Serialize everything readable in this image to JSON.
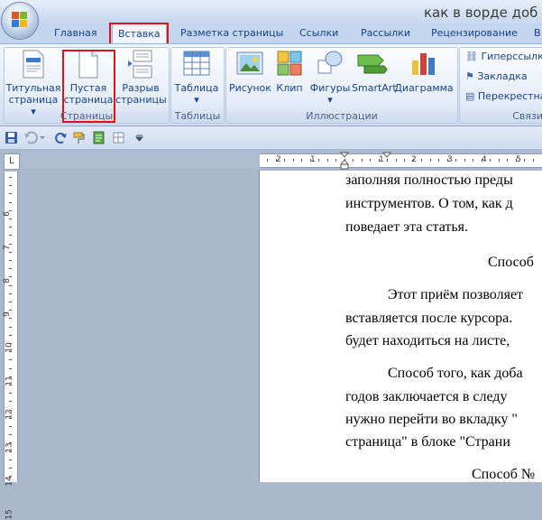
{
  "window": {
    "title": "как в ворде доб"
  },
  "tabs": [
    {
      "label": "Главная"
    },
    {
      "label": "Вставка"
    },
    {
      "label": "Разметка страницы"
    },
    {
      "label": "Ссылки"
    },
    {
      "label": "Рассылки"
    },
    {
      "label": "Рецензирование"
    },
    {
      "label": "В"
    }
  ],
  "ribbon": {
    "pages_group": {
      "label": "Страницы",
      "cover_page": {
        "line1": "Титульная",
        "line2": "страница ▾"
      },
      "blank_page": {
        "line1": "Пустая",
        "line2": "страница"
      },
      "page_break": {
        "line1": "Разрыв",
        "line2": "страницы"
      }
    },
    "tables_group": {
      "label": "Таблицы",
      "table": {
        "line1": "Таблица",
        "line2": "▾"
      }
    },
    "illustrations_group": {
      "label": "Иллюстрации",
      "picture": "Рисунок",
      "clip": "Клип",
      "shapes": {
        "line1": "Фигуры",
        "line2": "▾"
      },
      "smartart": "SmartArt",
      "chart": "Диаграмма"
    },
    "links_group": {
      "label": "Связи",
      "hyperlink": "Гиперссылка",
      "bookmark": "Закладка",
      "cross_reference": "Перекрестная"
    }
  },
  "ruler": {
    "corner": "L",
    "h_ticks": [
      "2",
      "1",
      "1",
      "2",
      "3",
      "4",
      "5",
      "6",
      "7",
      "8",
      "9"
    ],
    "v_ticks": [
      "6",
      "7",
      "8",
      "9",
      "10",
      "11",
      "12",
      "13",
      "14",
      "15"
    ]
  },
  "document": {
    "lines": [
      "заполняя полностью преды",
      "инструментов. О том, как д",
      "поведает эта статья.",
      "Способ",
      "Этот приём позволяет",
      "вставляется после курсора.",
      "будет находиться на листе,",
      "Способ того, как доба",
      "годов заключается в следу",
      "нужно перейти во вкладку \"",
      "страница\" в блоке \"Страни",
      "Способ №"
    ]
  },
  "colors": {
    "highlight": "#e0131b",
    "ribbon_text": "#15428b"
  }
}
